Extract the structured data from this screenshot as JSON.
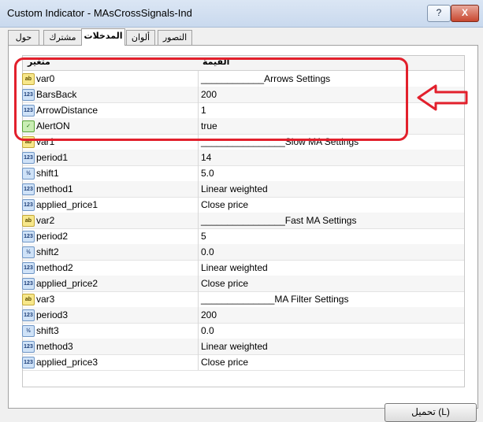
{
  "window": {
    "title": "Custom Indicator - MAsCrossSignals-Ind",
    "help_label": "?",
    "close_label": "X"
  },
  "tabs": [
    {
      "label": "حول"
    },
    {
      "label": "مشترك"
    },
    {
      "label": "المدخلات",
      "active": true
    },
    {
      "label": "ألوان"
    },
    {
      "label": "التصور"
    }
  ],
  "table": {
    "columns": {
      "variable": "متغير",
      "value": "القيمة"
    },
    "rows": [
      {
        "icon": "ab",
        "name": "var0",
        "value": "____________Arrows Settings"
      },
      {
        "icon": "123",
        "name": "BarsBack",
        "value": "200"
      },
      {
        "icon": "123",
        "name": "ArrowDistance",
        "value": "1"
      },
      {
        "icon": "bool",
        "name": "AlertON",
        "value": "true"
      },
      {
        "icon": "ab",
        "name": "var1",
        "value": "________________Slow MA Settings"
      },
      {
        "icon": "123",
        "name": "period1",
        "value": "14"
      },
      {
        "icon": "v2",
        "name": "shift1",
        "value": "5.0"
      },
      {
        "icon": "123",
        "name": "method1",
        "value": "Linear weighted"
      },
      {
        "icon": "123",
        "name": "applied_price1",
        "value": "Close price"
      },
      {
        "icon": "ab",
        "name": "var2",
        "value": "________________Fast MA Settings"
      },
      {
        "icon": "123",
        "name": "period2",
        "value": "5"
      },
      {
        "icon": "v2",
        "name": "shift2",
        "value": "0.0"
      },
      {
        "icon": "123",
        "name": "method2",
        "value": "Linear weighted"
      },
      {
        "icon": "123",
        "name": "applied_price2",
        "value": "Close price"
      },
      {
        "icon": "ab",
        "name": "var3",
        "value": "______________MA Filter Settings"
      },
      {
        "icon": "123",
        "name": "period3",
        "value": "200"
      },
      {
        "icon": "v2",
        "name": "shift3",
        "value": "0.0"
      },
      {
        "icon": "123",
        "name": "method3",
        "value": "Linear weighted"
      },
      {
        "icon": "123",
        "name": "applied_price3",
        "value": "Close price"
      }
    ]
  },
  "buttons": {
    "load": "تحميل (L)"
  },
  "colors": {
    "highlight": "#e2202c"
  }
}
